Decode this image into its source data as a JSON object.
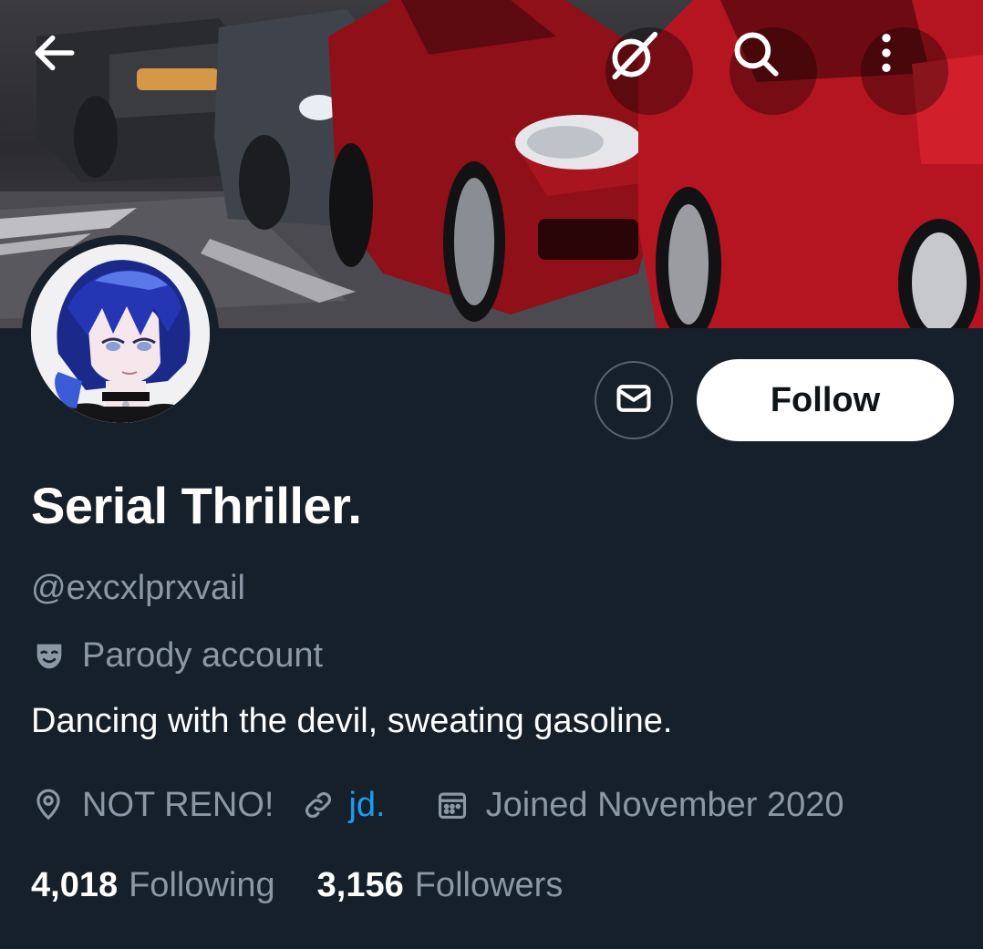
{
  "header": {
    "back_icon": "arrow-left-icon",
    "grok_icon": "grok-icon",
    "search_icon": "search-icon",
    "more_icon": "more-vertical-icon"
  },
  "profile": {
    "display_name": "Serial Thriller.",
    "handle": "@excxlprxvail",
    "parody_label": "Parody account",
    "bio": "Dancing with the devil, sweating gasoline.",
    "location": "NOT RENO!",
    "website": "jd.",
    "joined": "Joined November 2020",
    "following_count": "4,018",
    "following_label": "Following",
    "followers_count": "3,156",
    "followers_label": "Followers"
  },
  "actions": {
    "follow_label": "Follow",
    "message_icon": "envelope-icon"
  },
  "colors": {
    "background": "#15202b",
    "muted_text": "#8b98a5",
    "link": "#1d9bf0",
    "follow_button": "#ffffff"
  }
}
